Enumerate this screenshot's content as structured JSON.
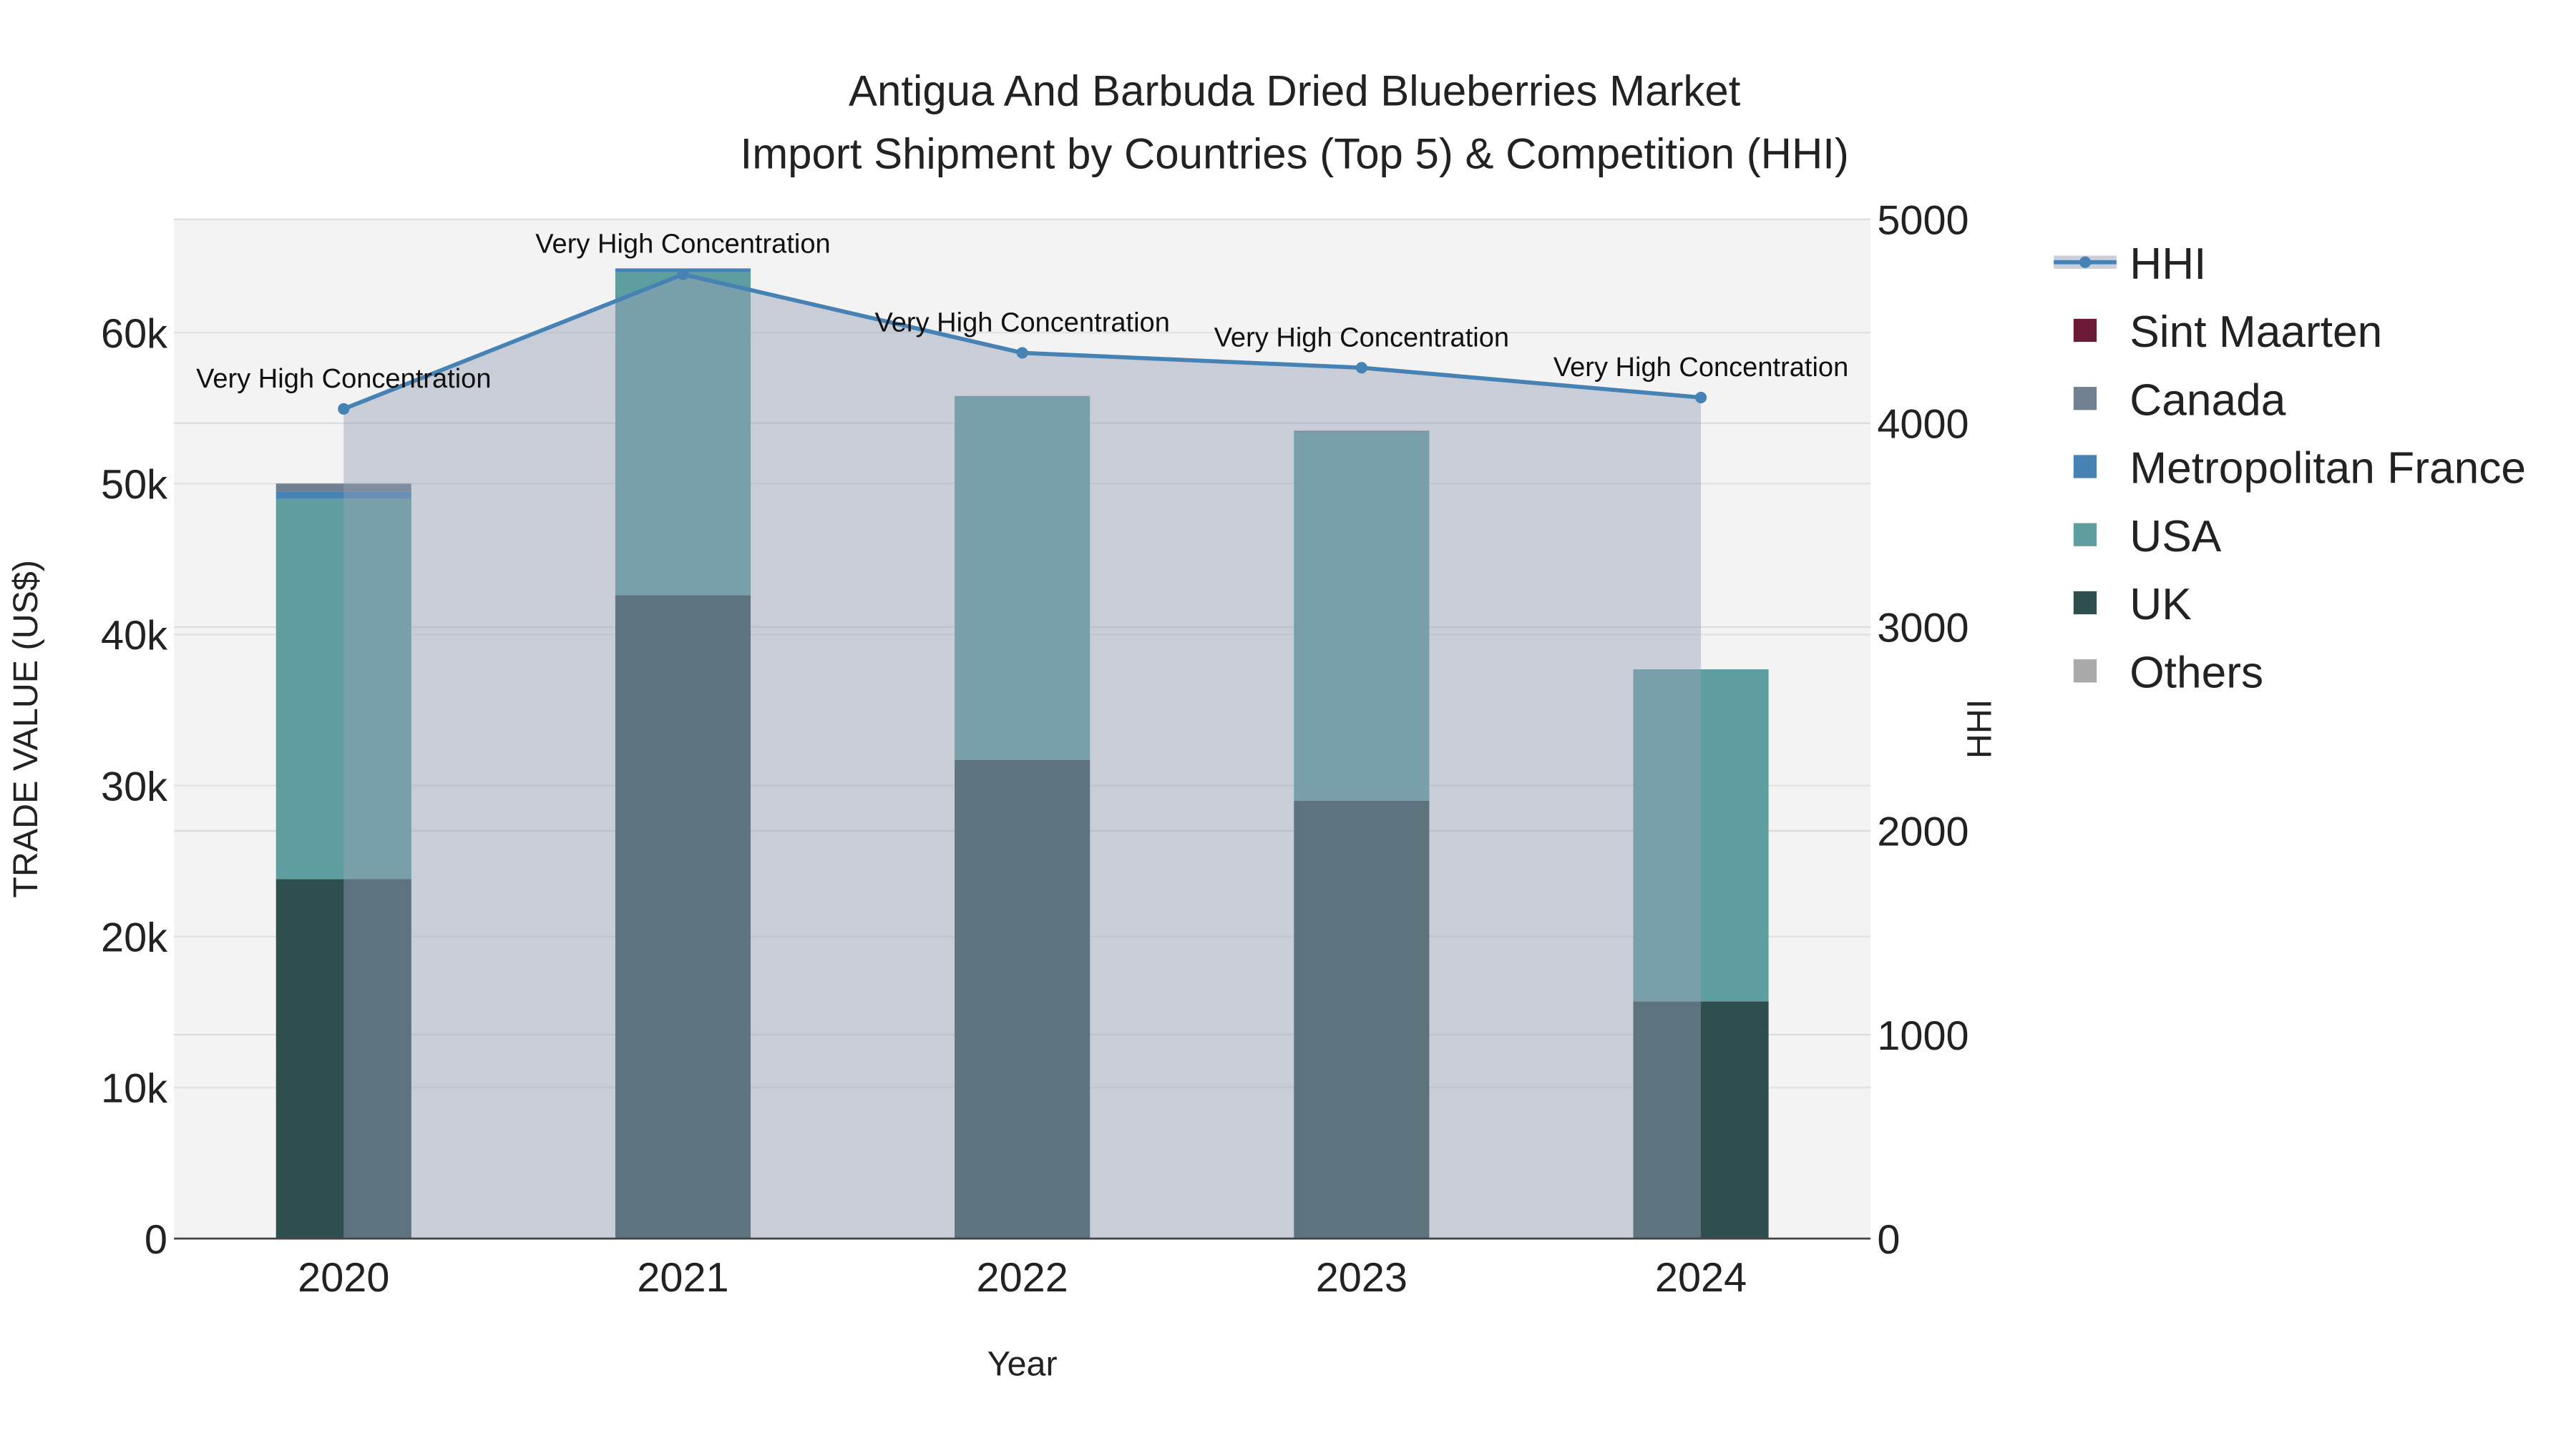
{
  "chart_data": {
    "type": "bar",
    "title": "Antigua And Barbuda Dried Blueberries Market",
    "subtitle": "Import Shipment by Countries (Top 5) & Competition (HHI)",
    "xlabel": "Year",
    "ylabel": "TRADE VALUE (US$)",
    "y2label": "HHI",
    "categories": [
      "2020",
      "2021",
      "2022",
      "2023",
      "2024"
    ],
    "ylim": [
      0,
      67500
    ],
    "y_ticks": [
      0,
      10000,
      20000,
      30000,
      40000,
      50000,
      60000
    ],
    "y_tick_labels": [
      "0",
      "10k",
      "20k",
      "30k",
      "40k",
      "50k",
      "60k"
    ],
    "y2lim": [
      0,
      5000
    ],
    "y2_ticks": [
      0,
      1000,
      2000,
      3000,
      4000,
      5000
    ],
    "y2_tick_labels": [
      "0",
      "1000",
      "2000",
      "3000",
      "4000",
      "5000"
    ],
    "stacked": true,
    "series": [
      {
        "name": "UK",
        "color": "#2f4f4f",
        "values": [
          23800,
          42600,
          31700,
          29000,
          15700
        ]
      },
      {
        "name": "USA",
        "color": "#5f9ea0",
        "values": [
          25200,
          21400,
          24100,
          24400,
          22000
        ]
      },
      {
        "name": "Metropolitan France",
        "color": "#4682b4",
        "values": [
          450,
          250,
          0,
          0,
          0
        ]
      },
      {
        "name": "Canada",
        "color": "#708090",
        "values": [
          550,
          0,
          0,
          100,
          0
        ]
      },
      {
        "name": "Sint Maarten",
        "color": "#6b1a3a",
        "values": [
          0,
          0,
          0,
          0,
          0
        ]
      },
      {
        "name": "Others",
        "color": "#a9a9a9",
        "values": [
          0,
          0,
          0,
          0,
          0
        ]
      }
    ],
    "hhi": {
      "name": "HHI",
      "color": "#4682b4",
      "values": [
        4070,
        4730,
        4345,
        4272,
        4126
      ]
    },
    "annotations": [
      "Very High Concentration",
      "Very High Concentration",
      "Very High Concentration",
      "Very High Concentration",
      "Very High Concentration"
    ],
    "legend": [
      "HHI",
      "Sint Maarten",
      "Canada",
      "Metropolitan France",
      "USA",
      "UK",
      "Others"
    ],
    "legend_position": "right",
    "grid": true
  }
}
